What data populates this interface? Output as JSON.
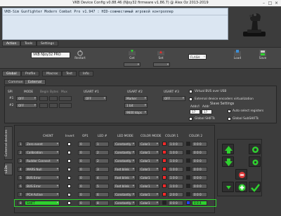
{
  "window": {
    "title": "VKB Device Config v0.88.46 (NJoy32 firmware v1.86.7) @ Alex Oz 2013-2019"
  },
  "banner": {
    "device_line": "VKB-Sim Gunfighter Modern Combat Pro  v1.947          : HID-совместимый игровой контроллер"
  },
  "main_tabs": [
    "Action",
    "Tools",
    "Settings"
  ],
  "toolbar": {
    "device_name": "VKB NJoy32 PRO",
    "restart_label": "Restart",
    "get_label": "Get",
    "set_label": "Set",
    "flash_value": "FLASH",
    "load_label": "Load",
    "save_label": "Save",
    "field1": "",
    "field2": ""
  },
  "sub_tabs": [
    "Global",
    "Profile",
    "Macros",
    "Test",
    "Info"
  ],
  "inner_tabs": [
    "Common",
    "External"
  ],
  "spi": {
    "heading": "SPI",
    "cols": [
      "MODE",
      "Begin",
      "Bytes",
      "Mux"
    ],
    "rows": [
      {
        "label": "#1",
        "mode": "OFF"
      },
      {
        "label": "#2",
        "mode": "OFF"
      }
    ]
  },
  "usart": {
    "titles": [
      "USART #1",
      "USART #2",
      "USART #3"
    ],
    "u1": [
      "OFF"
    ],
    "u2": [
      "Marker",
      "1 bit",
      "9600 kbps"
    ],
    "u3": [
      "OFF"
    ]
  },
  "options": {
    "virtual_bus": "Virtual BUS over USB",
    "ext_virtualization": "External device encoders virtualization",
    "slave_settings": "Slave Settings",
    "addr_l": "Addr/l",
    "addr": "Addr",
    "addr_l_value": "17",
    "addr_value": "17",
    "auto_select": "Auto select registers",
    "global_shifts": "Global SHIFTs",
    "global_subshifts": "Global SubSHIFTs"
  },
  "side_tabs": {
    "external": "External devices",
    "leds": "LEDs"
  },
  "led_table": {
    "headers": [
      "CHENT",
      "Invert",
      "OP1",
      "LED #",
      "LED MODE",
      "COLOR MODE",
      "COLOR 1",
      "COLOR 2"
    ],
    "rows": [
      {
        "num": "1",
        "name": "Zero event",
        "invert": false,
        "op": "0",
        "led": "1",
        "mode": "Constantly",
        "cmode": "Color1",
        "c1": "1 0 0",
        "c2": "0 0 0",
        "c1color": "#ff2a2a",
        "c2color": "#222222"
      },
      {
        "num": "2",
        "name": "Calibration",
        "invert": false,
        "op": "0",
        "led": "2",
        "mode": "Constantly",
        "cmode": "Color1",
        "c1": "1 0 0",
        "c2": "0 0 0",
        "c1color": "#ff2a2a",
        "c2color": "#222222"
      },
      {
        "num": "3",
        "name": "Rudder Connect",
        "invert": false,
        "op": "0",
        "led": "2",
        "mode": "Constantly",
        "cmode": "Color1",
        "c1": "1 0 0",
        "c2": "0 0 0",
        "c1color": "#ff2a2a",
        "c2color": "#222222"
      },
      {
        "num": "4",
        "name": "MARS Null",
        "invert": true,
        "op": "0",
        "led": "3",
        "mode": "Fast blink",
        "cmode": "Color1",
        "c1": "1 0 0",
        "c2": "0 0 0",
        "c1color": "#ff2a2a",
        "c2color": "#222222"
      },
      {
        "num": "5",
        "name": "BUS Error",
        "invert": true,
        "op": "0",
        "led": "4",
        "mode": "Fast blink",
        "cmode": "Color1",
        "c1": "1 0 0",
        "c2": "0 0 0",
        "c1color": "#ff2a2a",
        "c2color": "#222222"
      },
      {
        "num": "6",
        "name": "BUS Error",
        "invert": false,
        "op": "0",
        "led": "5",
        "mode": "Fast blink",
        "cmode": "Color1",
        "c1": "1 0 0",
        "c2": "0 0 0",
        "c1color": "#ff2a2a",
        "c2color": "#222222"
      },
      {
        "num": "7",
        "name": "PCH Active",
        "invert": true,
        "op": "0",
        "led": "6",
        "mode": "Constantly",
        "cmode": "Color1",
        "c1": "2 0 0",
        "c2": "0 0 0",
        "c1color": "#ff2a2a",
        "c2color": "#222222"
      },
      {
        "num": "8",
        "name": "SHIFT",
        "invert": false,
        "op": "0",
        "led": "8",
        "mode": "Constantly",
        "cmode": "Color1",
        "c1": "0 0 0",
        "c2": "0 0 4",
        "c1color": "#222222",
        "c2color": "#2244ff"
      }
    ]
  },
  "accent": "#2fd12f"
}
